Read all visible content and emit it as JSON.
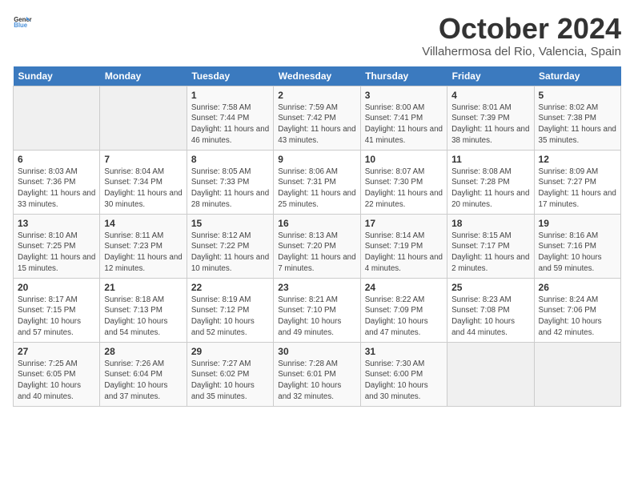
{
  "logo": {
    "general": "General",
    "blue": "Blue"
  },
  "title": "October 2024",
  "subtitle": "Villahermosa del Rio, Valencia, Spain",
  "headers": [
    "Sunday",
    "Monday",
    "Tuesday",
    "Wednesday",
    "Thursday",
    "Friday",
    "Saturday"
  ],
  "weeks": [
    [
      {
        "day": "",
        "sunrise": "",
        "sunset": "",
        "daylight": ""
      },
      {
        "day": "",
        "sunrise": "",
        "sunset": "",
        "daylight": ""
      },
      {
        "day": "1",
        "sunrise": "Sunrise: 7:58 AM",
        "sunset": "Sunset: 7:44 PM",
        "daylight": "Daylight: 11 hours and 46 minutes."
      },
      {
        "day": "2",
        "sunrise": "Sunrise: 7:59 AM",
        "sunset": "Sunset: 7:42 PM",
        "daylight": "Daylight: 11 hours and 43 minutes."
      },
      {
        "day": "3",
        "sunrise": "Sunrise: 8:00 AM",
        "sunset": "Sunset: 7:41 PM",
        "daylight": "Daylight: 11 hours and 41 minutes."
      },
      {
        "day": "4",
        "sunrise": "Sunrise: 8:01 AM",
        "sunset": "Sunset: 7:39 PM",
        "daylight": "Daylight: 11 hours and 38 minutes."
      },
      {
        "day": "5",
        "sunrise": "Sunrise: 8:02 AM",
        "sunset": "Sunset: 7:38 PM",
        "daylight": "Daylight: 11 hours and 35 minutes."
      }
    ],
    [
      {
        "day": "6",
        "sunrise": "Sunrise: 8:03 AM",
        "sunset": "Sunset: 7:36 PM",
        "daylight": "Daylight: 11 hours and 33 minutes."
      },
      {
        "day": "7",
        "sunrise": "Sunrise: 8:04 AM",
        "sunset": "Sunset: 7:34 PM",
        "daylight": "Daylight: 11 hours and 30 minutes."
      },
      {
        "day": "8",
        "sunrise": "Sunrise: 8:05 AM",
        "sunset": "Sunset: 7:33 PM",
        "daylight": "Daylight: 11 hours and 28 minutes."
      },
      {
        "day": "9",
        "sunrise": "Sunrise: 8:06 AM",
        "sunset": "Sunset: 7:31 PM",
        "daylight": "Daylight: 11 hours and 25 minutes."
      },
      {
        "day": "10",
        "sunrise": "Sunrise: 8:07 AM",
        "sunset": "Sunset: 7:30 PM",
        "daylight": "Daylight: 11 hours and 22 minutes."
      },
      {
        "day": "11",
        "sunrise": "Sunrise: 8:08 AM",
        "sunset": "Sunset: 7:28 PM",
        "daylight": "Daylight: 11 hours and 20 minutes."
      },
      {
        "day": "12",
        "sunrise": "Sunrise: 8:09 AM",
        "sunset": "Sunset: 7:27 PM",
        "daylight": "Daylight: 11 hours and 17 minutes."
      }
    ],
    [
      {
        "day": "13",
        "sunrise": "Sunrise: 8:10 AM",
        "sunset": "Sunset: 7:25 PM",
        "daylight": "Daylight: 11 hours and 15 minutes."
      },
      {
        "day": "14",
        "sunrise": "Sunrise: 8:11 AM",
        "sunset": "Sunset: 7:23 PM",
        "daylight": "Daylight: 11 hours and 12 minutes."
      },
      {
        "day": "15",
        "sunrise": "Sunrise: 8:12 AM",
        "sunset": "Sunset: 7:22 PM",
        "daylight": "Daylight: 11 hours and 10 minutes."
      },
      {
        "day": "16",
        "sunrise": "Sunrise: 8:13 AM",
        "sunset": "Sunset: 7:20 PM",
        "daylight": "Daylight: 11 hours and 7 minutes."
      },
      {
        "day": "17",
        "sunrise": "Sunrise: 8:14 AM",
        "sunset": "Sunset: 7:19 PM",
        "daylight": "Daylight: 11 hours and 4 minutes."
      },
      {
        "day": "18",
        "sunrise": "Sunrise: 8:15 AM",
        "sunset": "Sunset: 7:17 PM",
        "daylight": "Daylight: 11 hours and 2 minutes."
      },
      {
        "day": "19",
        "sunrise": "Sunrise: 8:16 AM",
        "sunset": "Sunset: 7:16 PM",
        "daylight": "Daylight: 10 hours and 59 minutes."
      }
    ],
    [
      {
        "day": "20",
        "sunrise": "Sunrise: 8:17 AM",
        "sunset": "Sunset: 7:15 PM",
        "daylight": "Daylight: 10 hours and 57 minutes."
      },
      {
        "day": "21",
        "sunrise": "Sunrise: 8:18 AM",
        "sunset": "Sunset: 7:13 PM",
        "daylight": "Daylight: 10 hours and 54 minutes."
      },
      {
        "day": "22",
        "sunrise": "Sunrise: 8:19 AM",
        "sunset": "Sunset: 7:12 PM",
        "daylight": "Daylight: 10 hours and 52 minutes."
      },
      {
        "day": "23",
        "sunrise": "Sunrise: 8:21 AM",
        "sunset": "Sunset: 7:10 PM",
        "daylight": "Daylight: 10 hours and 49 minutes."
      },
      {
        "day": "24",
        "sunrise": "Sunrise: 8:22 AM",
        "sunset": "Sunset: 7:09 PM",
        "daylight": "Daylight: 10 hours and 47 minutes."
      },
      {
        "day": "25",
        "sunrise": "Sunrise: 8:23 AM",
        "sunset": "Sunset: 7:08 PM",
        "daylight": "Daylight: 10 hours and 44 minutes."
      },
      {
        "day": "26",
        "sunrise": "Sunrise: 8:24 AM",
        "sunset": "Sunset: 7:06 PM",
        "daylight": "Daylight: 10 hours and 42 minutes."
      }
    ],
    [
      {
        "day": "27",
        "sunrise": "Sunrise: 7:25 AM",
        "sunset": "Sunset: 6:05 PM",
        "daylight": "Daylight: 10 hours and 40 minutes."
      },
      {
        "day": "28",
        "sunrise": "Sunrise: 7:26 AM",
        "sunset": "Sunset: 6:04 PM",
        "daylight": "Daylight: 10 hours and 37 minutes."
      },
      {
        "day": "29",
        "sunrise": "Sunrise: 7:27 AM",
        "sunset": "Sunset: 6:02 PM",
        "daylight": "Daylight: 10 hours and 35 minutes."
      },
      {
        "day": "30",
        "sunrise": "Sunrise: 7:28 AM",
        "sunset": "Sunset: 6:01 PM",
        "daylight": "Daylight: 10 hours and 32 minutes."
      },
      {
        "day": "31",
        "sunrise": "Sunrise: 7:30 AM",
        "sunset": "Sunset: 6:00 PM",
        "daylight": "Daylight: 10 hours and 30 minutes."
      },
      {
        "day": "",
        "sunrise": "",
        "sunset": "",
        "daylight": ""
      },
      {
        "day": "",
        "sunrise": "",
        "sunset": "",
        "daylight": ""
      }
    ]
  ]
}
